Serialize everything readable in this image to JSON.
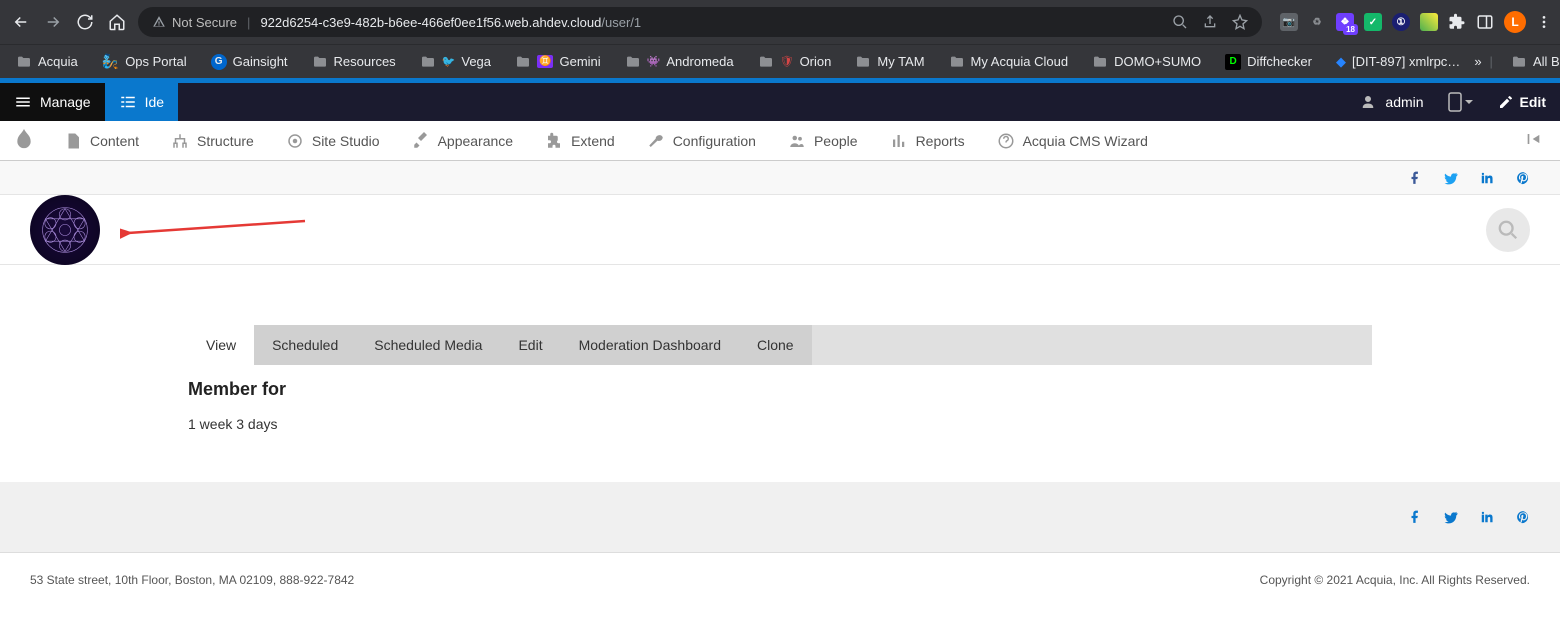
{
  "browser": {
    "not_secure": "Not Secure",
    "url_host": "922d6254-c3e9-482b-b6ee-466ef0ee1f56.web.ahdev.cloud",
    "url_path": "/user/1",
    "avatar_letter": "L",
    "ext_badge_count": "18"
  },
  "bookmarks": {
    "items": [
      "Acquia",
      "Ops Portal",
      "Gainsight",
      "Resources",
      "Vega",
      "Gemini",
      "Andromeda",
      "Orion",
      "My TAM",
      "My Acquia Cloud",
      "DOMO+SUMO",
      "Diffchecker",
      "[DIT-897] xmlrpc…"
    ],
    "all": "All Bookmarks"
  },
  "admin_top": {
    "manage": "Manage",
    "ide": "Ide",
    "user": "admin",
    "edit": "Edit"
  },
  "admin_sec": {
    "items": [
      "Content",
      "Structure",
      "Site Studio",
      "Appearance",
      "Extend",
      "Configuration",
      "People",
      "Reports",
      "Acquia CMS Wizard"
    ]
  },
  "tabs": {
    "items": [
      "View",
      "Scheduled",
      "Scheduled Media",
      "Edit",
      "Moderation Dashboard",
      "Clone"
    ],
    "active_index": 0
  },
  "profile": {
    "member_label": "Member for",
    "member_value": "1 week 3 days"
  },
  "footer": {
    "address": "53 State street, 10th Floor, Boston, MA 02109, 888-922-7842",
    "copyright": "Copyright © 2021 Acquia, Inc. All Rights Reserved."
  }
}
